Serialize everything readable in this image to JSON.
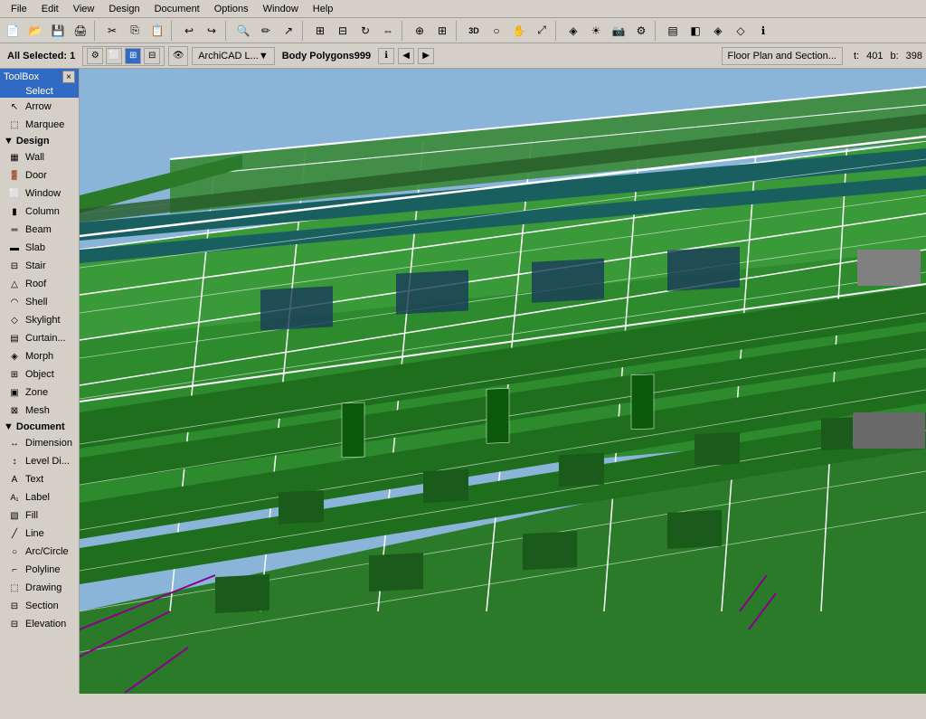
{
  "menubar": {
    "items": [
      "File",
      "Edit",
      "View",
      "Design",
      "Document",
      "Options",
      "Window",
      "Help"
    ]
  },
  "toolbox": {
    "title": "ToolBox",
    "close_label": "×",
    "select_label": "Select",
    "select_tools": [
      {
        "name": "Arrow",
        "icon": "↖"
      },
      {
        "name": "Marquee",
        "icon": "⬚"
      }
    ],
    "sections": [
      {
        "name": "Design",
        "items": [
          {
            "name": "Wall",
            "icon": "▦"
          },
          {
            "name": "Door",
            "icon": "🚪"
          },
          {
            "name": "Window",
            "icon": "⬜"
          },
          {
            "name": "Column",
            "icon": "▮"
          },
          {
            "name": "Beam",
            "icon": "═"
          },
          {
            "name": "Slab",
            "icon": "▬"
          },
          {
            "name": "Stair",
            "icon": "⊟"
          },
          {
            "name": "Roof",
            "icon": "△"
          },
          {
            "name": "Shell",
            "icon": "◠"
          },
          {
            "name": "Skylight",
            "icon": "◇"
          },
          {
            "name": "Curtain...",
            "icon": "▤"
          },
          {
            "name": "Morph",
            "icon": "◈"
          },
          {
            "name": "Object",
            "icon": "⊞"
          },
          {
            "name": "Zone",
            "icon": "▣"
          },
          {
            "name": "Mesh",
            "icon": "⊠"
          }
        ]
      },
      {
        "name": "Document",
        "items": [
          {
            "name": "Dimension",
            "icon": "↔"
          },
          {
            "name": "Level Di...",
            "icon": "↕"
          },
          {
            "name": "Text",
            "icon": "A"
          },
          {
            "name": "Label",
            "icon": "A₁"
          },
          {
            "name": "Fill",
            "icon": "▧"
          },
          {
            "name": "Line",
            "icon": "╱"
          },
          {
            "name": "Arc/Circle",
            "icon": "○"
          },
          {
            "name": "Polyline",
            "icon": "⌐"
          },
          {
            "name": "Drawing",
            "icon": "⬚"
          },
          {
            "name": "Section",
            "icon": "⊟"
          },
          {
            "name": "Elevation",
            "icon": "⊟"
          }
        ]
      }
    ]
  },
  "infobar": {
    "selection_count": "All Selected: 1",
    "body_label": "Body Polygons999",
    "info_icon": "ℹ",
    "layer_label": "ArchiCAD L...",
    "nav_prev": "◀",
    "nav_next": "▶",
    "floor_plan_btn": "Floor Plan and Section...",
    "coords": {
      "t_label": "t:",
      "t_value": "401",
      "b_label": "b:",
      "b_value": "398"
    }
  },
  "viewport": {
    "bg_color": "#8ab4d8"
  },
  "colors": {
    "green_main": "#2d8a2d",
    "green_light": "#4caf50",
    "white_lines": "#ffffff",
    "purple": "#8b008b",
    "blue_bg": "#8ab4d8",
    "gray_struct": "#808080"
  }
}
